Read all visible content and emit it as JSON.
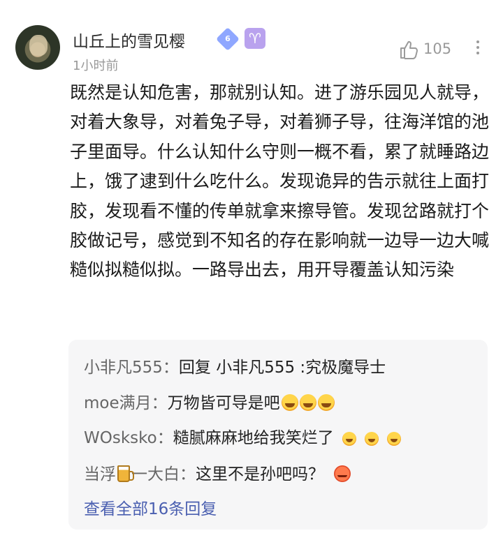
{
  "comment": {
    "username": "山丘上的雪见樱",
    "level_badge": "6",
    "zodiac_badge": "♈",
    "time": "1小时前",
    "like_count": "105",
    "text": "既然是认知危害，那就别认知。进了游乐园见人就导，对着大象导，对着兔子导，对着狮子导，往海洋馆的池子里面导。什么认知什么守则一概不看，累了就睡路边上，饿了逮到什么吃什么。发现诡异的告示就往上面打胶，发现看不懂的传单就拿来擦导管。发现岔路就打个胶做记号，感觉到不知名的存在影响就一边导一边大喊糙似拟糙似拟。一路导出去，用开导覆盖认知污染"
  },
  "replies": [
    {
      "name": "小非凡555：",
      "text": "回复  小非凡555 :究极魔导士"
    },
    {
      "name": "moe满月：",
      "text": "万物皆可导是吧"
    },
    {
      "name": "WOsksko：",
      "text": "糙腻麻麻地给我笑烂了"
    },
    {
      "name_prefix": "当浮",
      "name_suffix": "一大白：",
      "text": "这里不是孙吧吗？"
    }
  ],
  "view_all": "查看全部16条回复",
  "icons": {
    "like": "thumbs-up-icon",
    "more": "more-vertical-icon",
    "emoji_grin_sweat": "grinning-sweat-emoji",
    "emoji_laugh": "laughing-emoji",
    "emoji_angry": "angry-emoji",
    "beer": "beer-mug-icon"
  },
  "colors": {
    "link": "#4a5fb0",
    "level_badge": "#8fa7ff",
    "zodiac_badge": "#b9a2ee",
    "reply_bg": "#f6f6f7"
  }
}
